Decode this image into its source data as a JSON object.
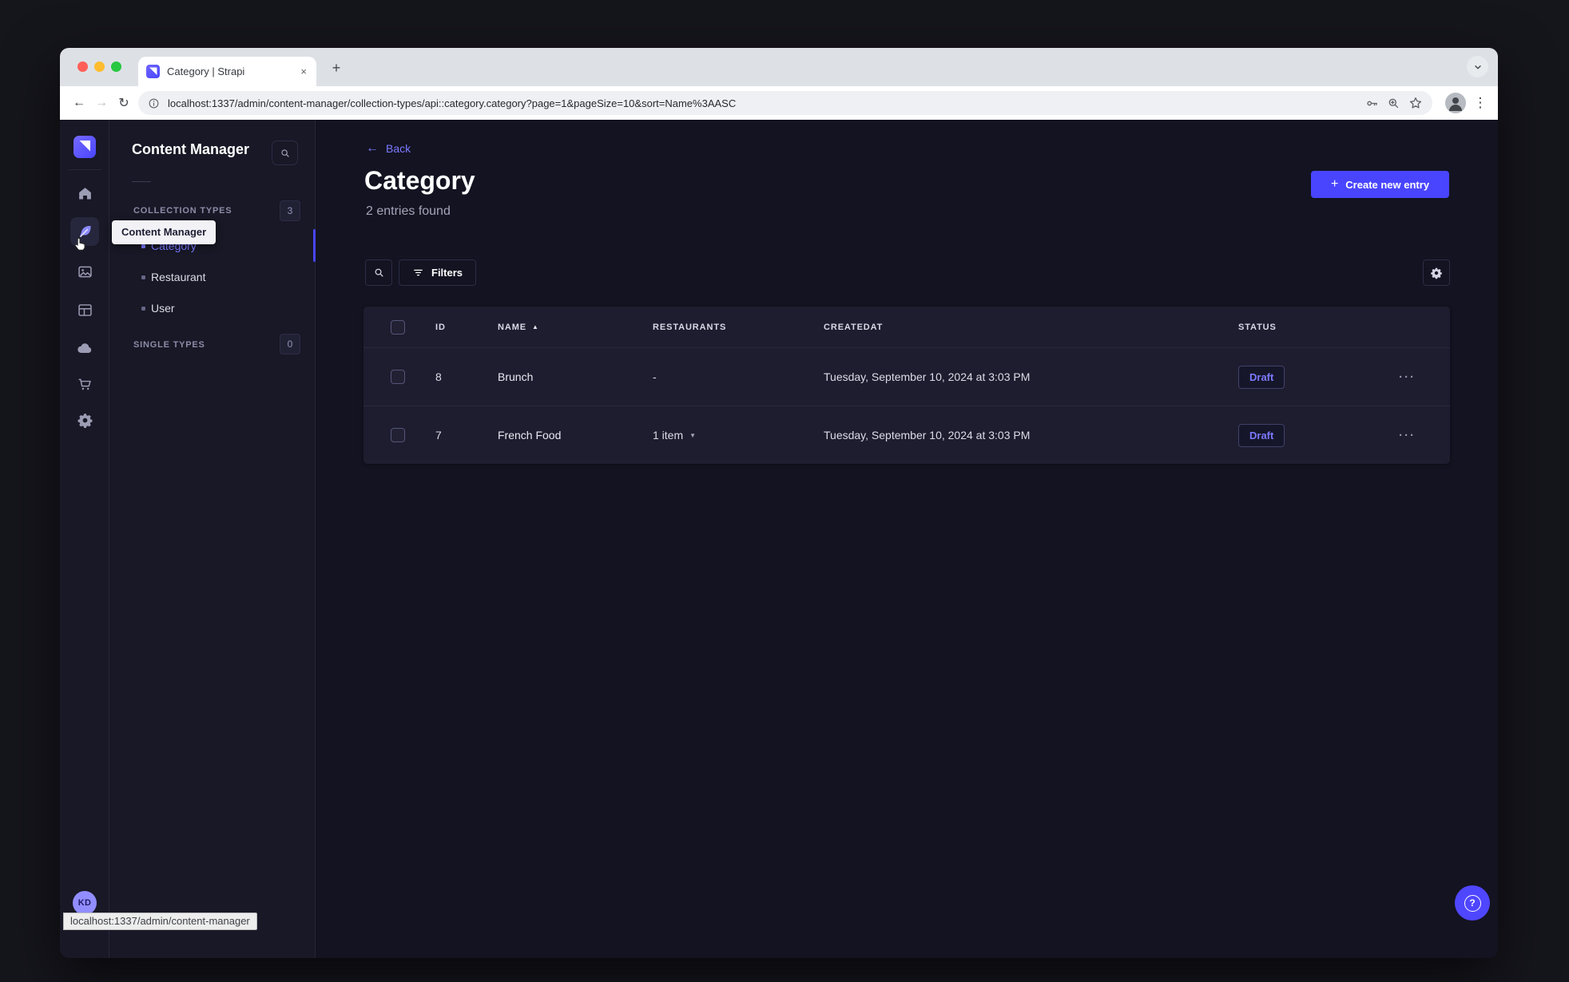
{
  "colors": {
    "accent": "#4945ff",
    "primary_light": "#7b79ff",
    "traffic_red": "#ff5f57",
    "traffic_yellow": "#febc2e",
    "traffic_green": "#28c840",
    "app_background": "#181826",
    "card_background": "#1d1d2f"
  },
  "glyphs": {
    "close": "×",
    "plus": "+",
    "back_arrow": "←",
    "forward_arrow": "→",
    "reload": "↻",
    "dots_vertical": "⋮",
    "dots_horizontal": "···",
    "sort_asc": "▲",
    "caret_down": "▼",
    "question": "?"
  },
  "browser": {
    "tab_title": "Category | Strapi",
    "url": "localhost:1337/admin/content-manager/collection-types/api::category.category?page=1&pageSize=10&sort=Name%3AASC",
    "status_bar": "localhost:1337/admin/content-manager"
  },
  "rail": {
    "avatar_initials": "KD",
    "icons": [
      "strapi-logo",
      "home",
      "content-manager",
      "media-library",
      "content-type-builder",
      "cloud",
      "marketplace",
      "settings"
    ]
  },
  "subnav": {
    "title": "Content Manager",
    "sections": [
      {
        "label": "COLLECTION TYPES",
        "count": "3",
        "items": [
          {
            "label": "Category"
          },
          {
            "label": "Restaurant"
          },
          {
            "label": "User"
          }
        ]
      },
      {
        "label": "SINGLE TYPES",
        "count": "0",
        "items": []
      }
    ]
  },
  "tooltip": {
    "text": "Content Manager"
  },
  "main": {
    "back_label": "Back",
    "title": "Category",
    "subtitle": "2 entries found",
    "create_button": "Create new entry",
    "filters_button": "Filters",
    "table": {
      "headers": [
        "ID",
        "NAME",
        "RESTAURANTS",
        "CREATEDAT",
        "STATUS"
      ],
      "rows": [
        {
          "id": "8",
          "name": "Brunch",
          "restaurants": "-",
          "created": "Tuesday, September 10, 2024 at 3:03 PM",
          "status": "Draft"
        },
        {
          "id": "7",
          "name": "French Food",
          "restaurants": "1 item",
          "created": "Tuesday, September 10, 2024 at 3:03 PM",
          "status": "Draft"
        }
      ]
    }
  }
}
